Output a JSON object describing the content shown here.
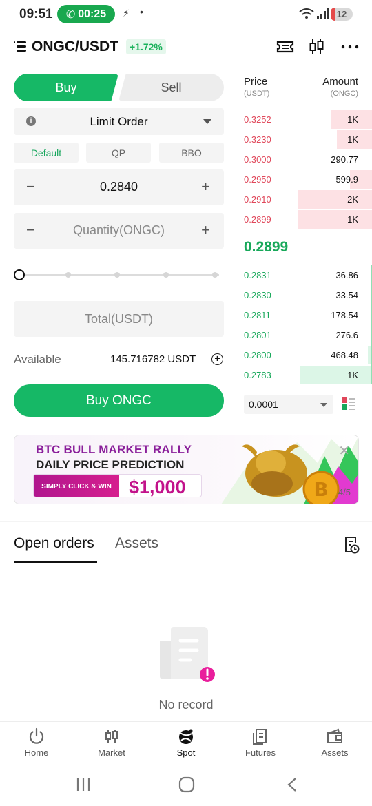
{
  "status_bar": {
    "time": "09:51",
    "call_timer": "00:25",
    "battery": "12"
  },
  "header": {
    "pair": "ONGC/USDT",
    "change": "+1.72%"
  },
  "trade": {
    "buy_tab": "Buy",
    "sell_tab": "Sell",
    "order_type": "Limit Order",
    "mini_tabs": [
      "Default",
      "QP",
      "BBO"
    ],
    "price_value": "0.2840",
    "quantity_placeholder": "Quantity(ONGC)",
    "total_placeholder": "Total(USDT)",
    "available_label": "Available",
    "available_value": "145.716782 USDT",
    "buy_button": "Buy ONGC",
    "slider_percent": 0
  },
  "orderbook": {
    "price_header": "Price",
    "price_unit": "(USDT)",
    "amount_header": "Amount",
    "amount_unit": "(ONGC)",
    "asks": [
      {
        "price": "0.3252",
        "amount": "1K",
        "depth": 0.56
      },
      {
        "price": "0.3230",
        "amount": "1K",
        "depth": 0.47
      },
      {
        "price": "0.3000",
        "amount": "290.77",
        "depth": 0.0
      },
      {
        "price": "0.2950",
        "amount": "599.9",
        "depth": 0.3
      },
      {
        "price": "0.2910",
        "amount": "2K",
        "depth": 1.0
      },
      {
        "price": "0.2899",
        "amount": "1K",
        "depth": 1.0
      }
    ],
    "last_price": "0.2899",
    "bids": [
      {
        "price": "0.2831",
        "amount": "36.86",
        "depth": 0.0
      },
      {
        "price": "0.2830",
        "amount": "33.54",
        "depth": 0.02
      },
      {
        "price": "0.2811",
        "amount": "178.54",
        "depth": 0.0
      },
      {
        "price": "0.2801",
        "amount": "276.6",
        "depth": 0.0
      },
      {
        "price": "0.2800",
        "amount": "468.48",
        "depth": 0.06
      },
      {
        "price": "0.2783",
        "amount": "1K",
        "depth": 0.97
      }
    ],
    "precision": "0.0001"
  },
  "banner": {
    "line1": "BTC BULL MARKET RALLY",
    "line2": "DAILY PRICE PREDICTION",
    "cta": "SIMPLY CLICK & WIN",
    "prize": "$1,000",
    "page": "4/5"
  },
  "orders": {
    "tab_open": "Open orders",
    "tab_assets": "Assets",
    "empty": "No record"
  },
  "bottom_nav": [
    {
      "label": "Home",
      "icon": "power-icon"
    },
    {
      "label": "Market",
      "icon": "candlestick-icon"
    },
    {
      "label": "Spot",
      "icon": "spot-icon"
    },
    {
      "label": "Futures",
      "icon": "futures-icon"
    },
    {
      "label": "Assets",
      "icon": "wallet-icon"
    }
  ],
  "colors": {
    "buy": "#16b866",
    "ask": "#e0475a",
    "bid": "#18a85a",
    "ask_bg": "#fde1e4",
    "bid_bg": "#dcf6e7"
  }
}
